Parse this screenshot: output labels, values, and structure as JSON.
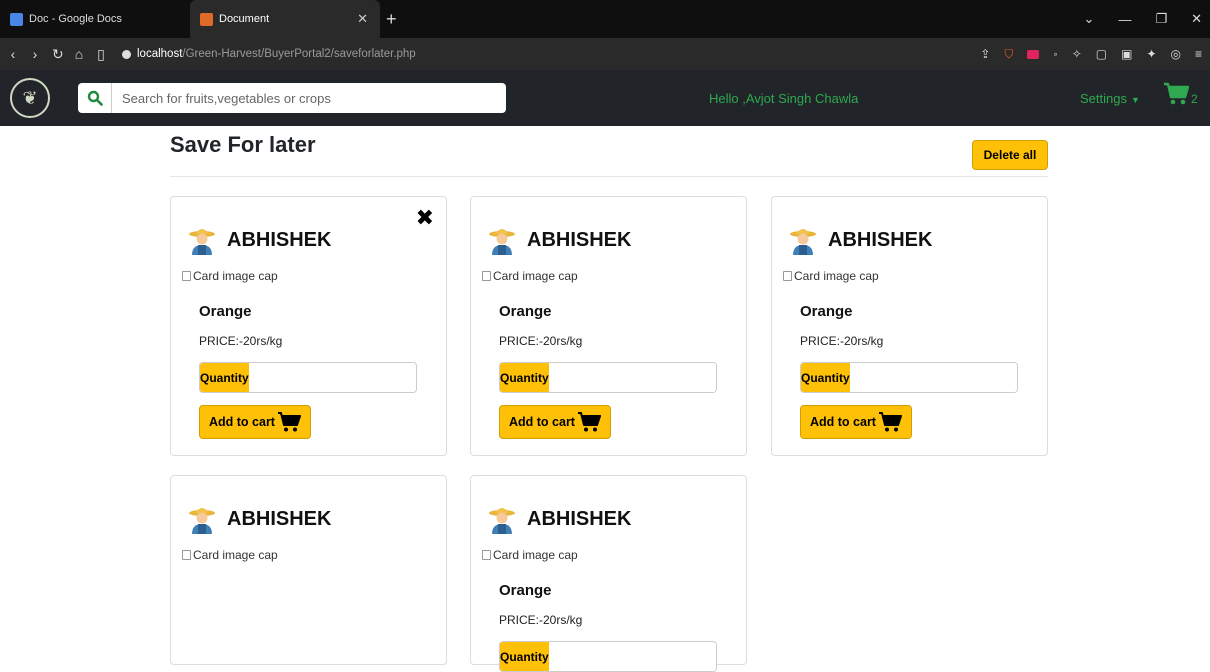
{
  "browser": {
    "tabs": [
      {
        "title": "Doc - Google Docs"
      },
      {
        "title": "Document"
      }
    ],
    "url_host": "localhost",
    "url_path": "/Green-Harvest/BuyerPortal2/saveforlater.php"
  },
  "navbar": {
    "search_placeholder": "Search for fruits,vegetables or crops",
    "greeting": "Hello ,Avjot Singh Chawla",
    "settings_label": "Settings",
    "cart_count": "2"
  },
  "page": {
    "title": "Save For later",
    "delete_all_label": "Delete all"
  },
  "cards": [
    {
      "farmer": "ABHISHEK",
      "image_alt": "Card image cap",
      "product": "Orange",
      "price": "PRICE:-20rs/kg",
      "quantity_label": "Quantity",
      "add_to_cart_label": "Add to cart"
    },
    {
      "farmer": "ABHISHEK",
      "image_alt": "Card image cap",
      "product": "Orange",
      "price": "PRICE:-20rs/kg",
      "quantity_label": "Quantity",
      "add_to_cart_label": "Add to cart"
    },
    {
      "farmer": "ABHISHEK",
      "image_alt": "Card image cap",
      "product": "Orange",
      "price": "PRICE:-20rs/kg",
      "quantity_label": "Quantity",
      "add_to_cart_label": "Add to cart"
    },
    {
      "farmer": "ABHISHEK",
      "image_alt": "Card image cap"
    },
    {
      "farmer": "ABHISHEK",
      "image_alt": "Card image cap",
      "product": "Orange",
      "price": "PRICE:-20rs/kg",
      "quantity_label": "Quantity"
    }
  ],
  "colors": {
    "accent": "#ffc107",
    "brand_green": "#2fa84f",
    "navbar_bg": "#212529"
  }
}
